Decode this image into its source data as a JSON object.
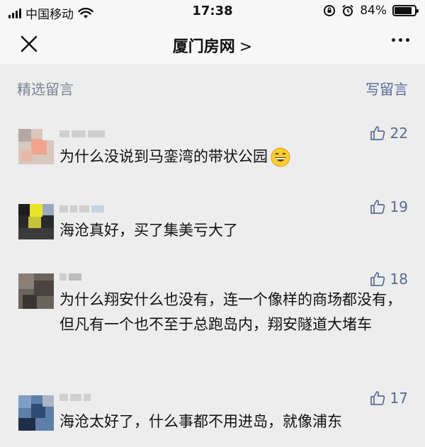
{
  "status_bar": {
    "carrier": "中国移动",
    "time": "17:38",
    "battery": "84%",
    "battery_level": 0.84
  },
  "nav": {
    "title": "厦门房网",
    "chevron": ">"
  },
  "section": {
    "title": "精选留言",
    "write_label": "写留言"
  },
  "comments": [
    {
      "text": "为什么没说到马銮湾的带状公园",
      "likes": "22",
      "has_emoji": true,
      "emoji": "grinning-face-emoji"
    },
    {
      "text": "海沧真好，买了集美亏大了",
      "likes": "19"
    },
    {
      "text": "为什么翔安什么也没有，连一个像样的商场都没有，但凡有一个也不至于总跑岛内，翔安隧道大堵车",
      "likes": "18"
    },
    {
      "text": "海沧太好了，什么事都不用进岛，就像浦东",
      "likes": "17"
    }
  ],
  "colors": {
    "link_blue": "#576b95",
    "muted_gray": "#7c8594",
    "background": "#ededed",
    "bar_background": "#f7f7f7"
  }
}
